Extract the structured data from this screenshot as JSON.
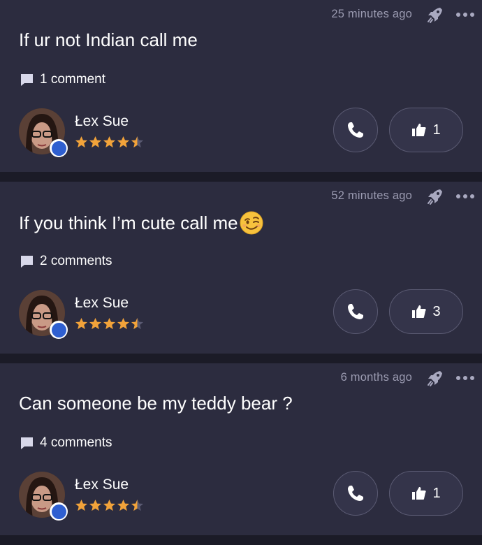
{
  "colors": {
    "background": "#1b1b27",
    "card": "#2c2c3f",
    "muted_text": "#9a9ab0",
    "star": "#f2a33a",
    "badge": "#2f5fd0"
  },
  "posts": [
    {
      "time": "25 minutes ago",
      "text": "If ur not Indian call me",
      "emoji": "",
      "comments": "1 comment",
      "author": "Łex Sue",
      "rating": 4.5,
      "likes": "1"
    },
    {
      "time": "52 minutes ago",
      "text": "If you think I’m cute call me",
      "emoji": "wink-emoji",
      "comments": "2 comments",
      "author": "Łex Sue",
      "rating": 4.5,
      "likes": "3"
    },
    {
      "time": "6 months ago",
      "text": "Can someone be my teddy bear ?",
      "emoji": "",
      "comments": "4 comments",
      "author": "Łex Sue",
      "rating": 4.5,
      "likes": "1"
    }
  ],
  "icons": {
    "boost": "rocket-icon",
    "more": "more-dots-icon",
    "comment": "comment-bubble-icon",
    "call": "phone-icon",
    "like": "thumbs-up-icon"
  }
}
